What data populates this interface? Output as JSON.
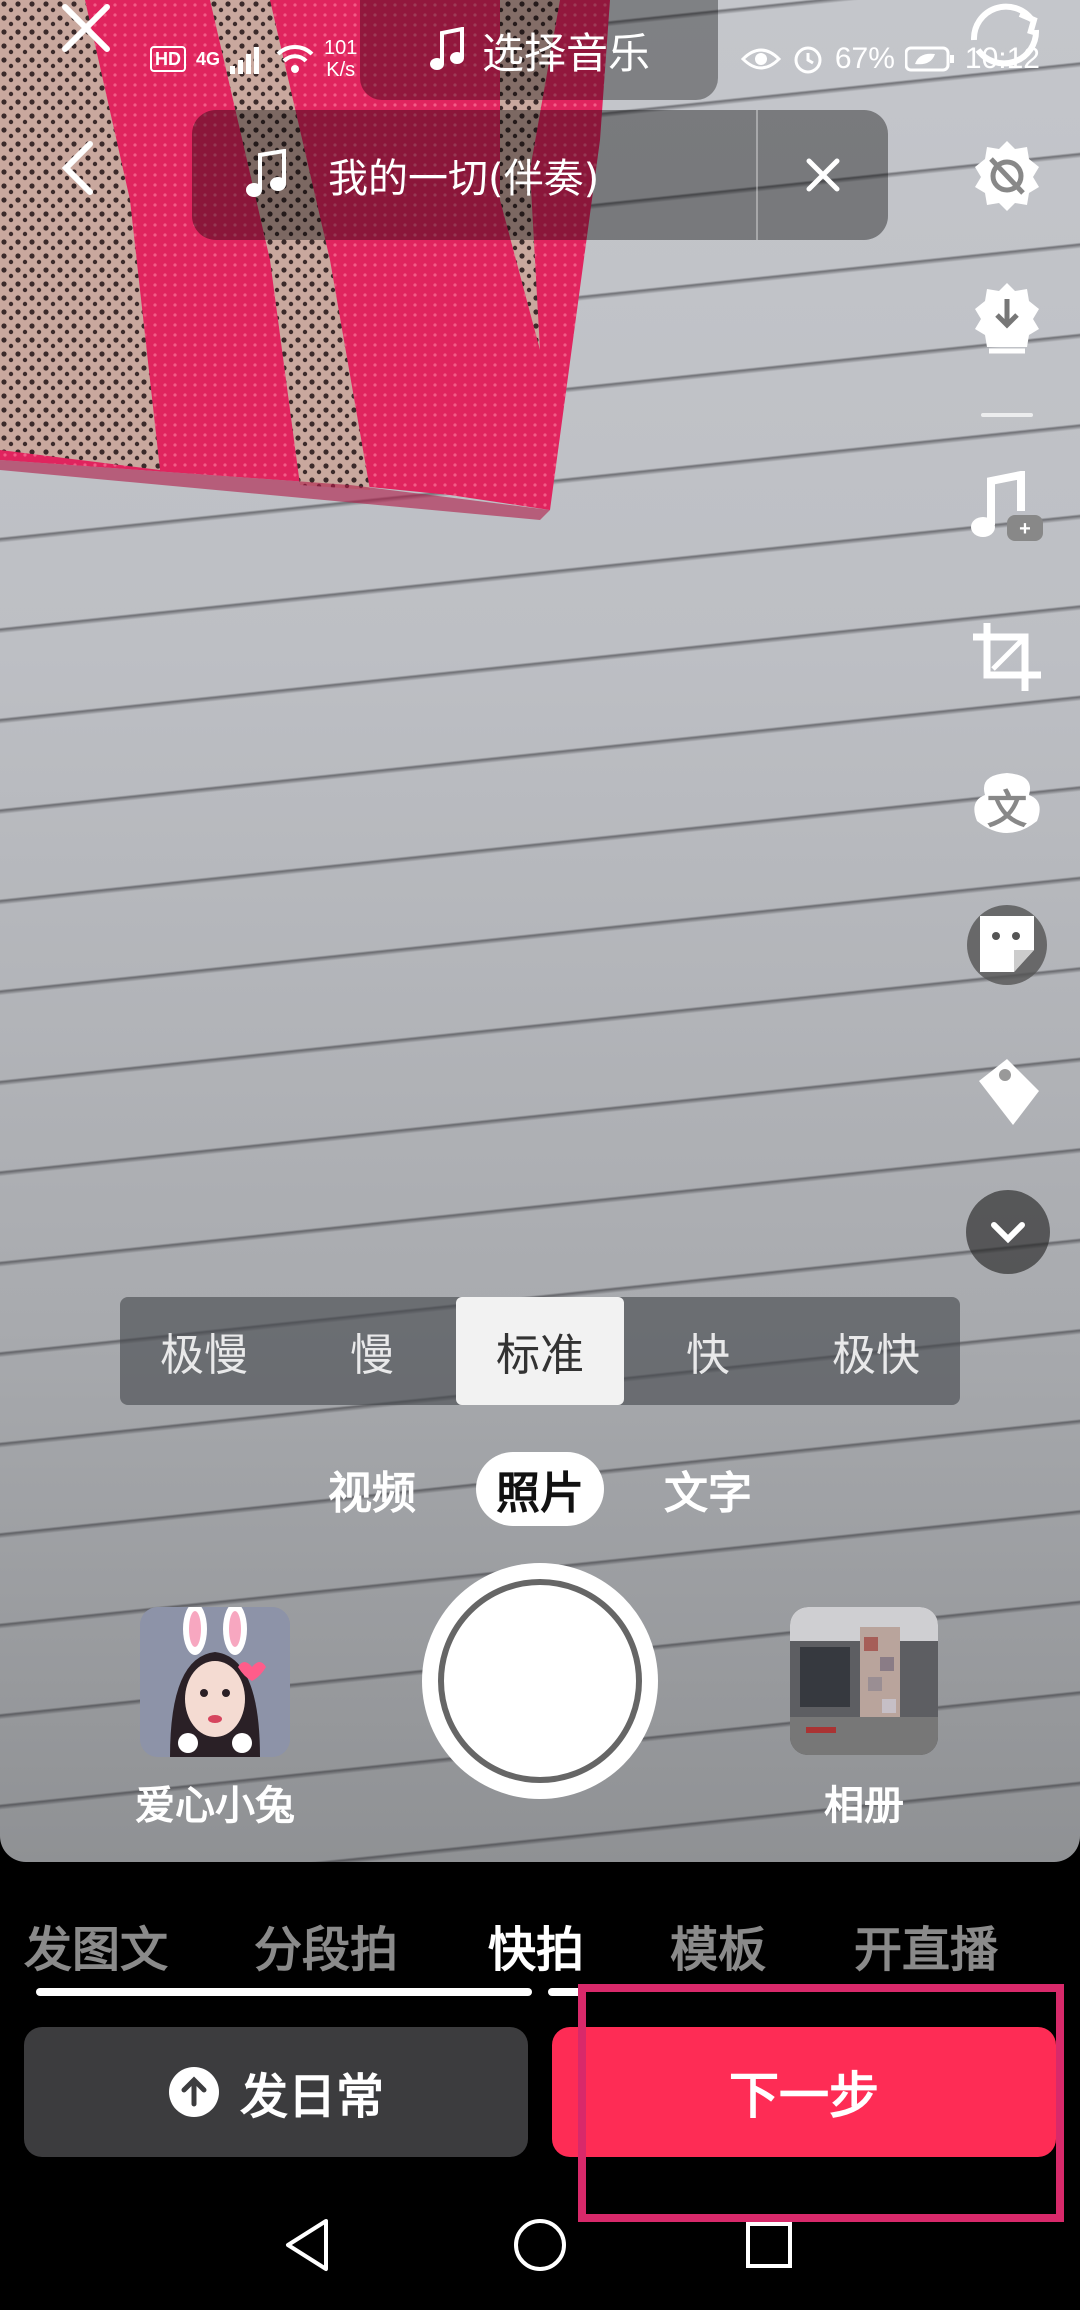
{
  "status_bar": {
    "hd": "HD",
    "network": "4G",
    "speed_value": "101",
    "speed_unit": "K/s",
    "battery": "67%",
    "time": "10:12"
  },
  "top": {
    "choose_music": "选择音乐",
    "song_title": "我的一切(伴奏)"
  },
  "side_tools": [
    "settings-icon",
    "download-icon",
    "music-edit-icon",
    "crop-icon",
    "text-icon",
    "sticker-icon",
    "tag-icon",
    "chevron-down-icon"
  ],
  "speed": {
    "options": [
      "极慢",
      "慢",
      "标准",
      "快",
      "极快"
    ],
    "selected": "标准"
  },
  "modes": {
    "options": [
      "视频",
      "照片",
      "文字"
    ],
    "selected": "照片"
  },
  "capture": {
    "effect_label": "爱心小兔",
    "album_label": "相册"
  },
  "bottom_tabs": {
    "items": [
      "发图文",
      "分段拍",
      "快拍",
      "模板",
      "开直播"
    ],
    "selected": "快拍"
  },
  "actions": {
    "daily": "发日常",
    "next": "下一步"
  },
  "colors": {
    "accent": "#fe2c55",
    "highlight": "#d8296a",
    "fabric_pink": "#e0245e"
  }
}
